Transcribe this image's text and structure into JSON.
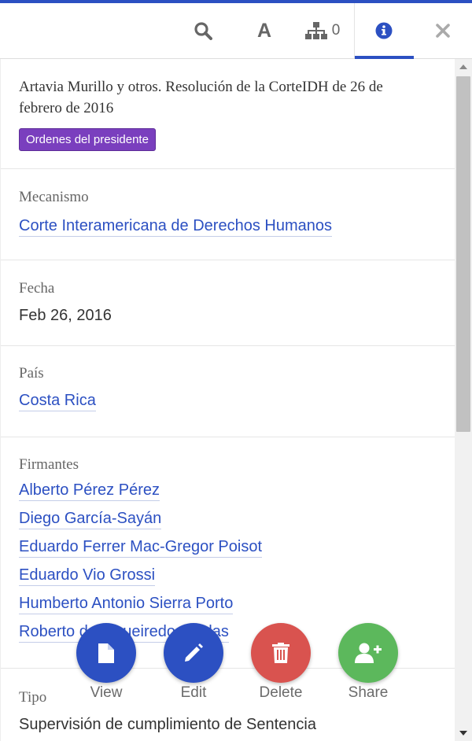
{
  "toolbar": {
    "tree_count": "0",
    "font_glyph": "A",
    "accent_color": "#2c50c2"
  },
  "document": {
    "title": "Artavia Murillo y otros. Resolución de la CorteIDH de 26 de febrero de 2016",
    "badge": "Ordenes del presidente",
    "badge_color": "#7a3fbe"
  },
  "metadata": {
    "mecanismo": {
      "label": "Mecanismo",
      "value": "Corte Interamericana de Derechos Humanos"
    },
    "fecha": {
      "label": "Fecha",
      "value": "Feb 26, 2016"
    },
    "pais": {
      "label": "País",
      "value": "Costa Rica"
    },
    "firmantes": {
      "label": "Firmantes",
      "items": [
        "Alberto Pérez Pérez",
        "Diego García-Sayán",
        "Eduardo Ferrer Mac-Gregor Poisot",
        "Eduardo Vio Grossi",
        "Humberto Antonio Sierra Porto",
        "Roberto de Figueiredo Caldas"
      ]
    },
    "tipo": {
      "label": "Tipo",
      "value": "Supervisión de cumplimiento de Sentencia"
    }
  },
  "actions": {
    "view": {
      "label": "View",
      "color": "#2c50c2"
    },
    "edit": {
      "label": "Edit",
      "color": "#2c50c2"
    },
    "delete": {
      "label": "Delete",
      "color": "#d9534f"
    },
    "share": {
      "label": "Share",
      "color": "#5cb85c"
    }
  }
}
